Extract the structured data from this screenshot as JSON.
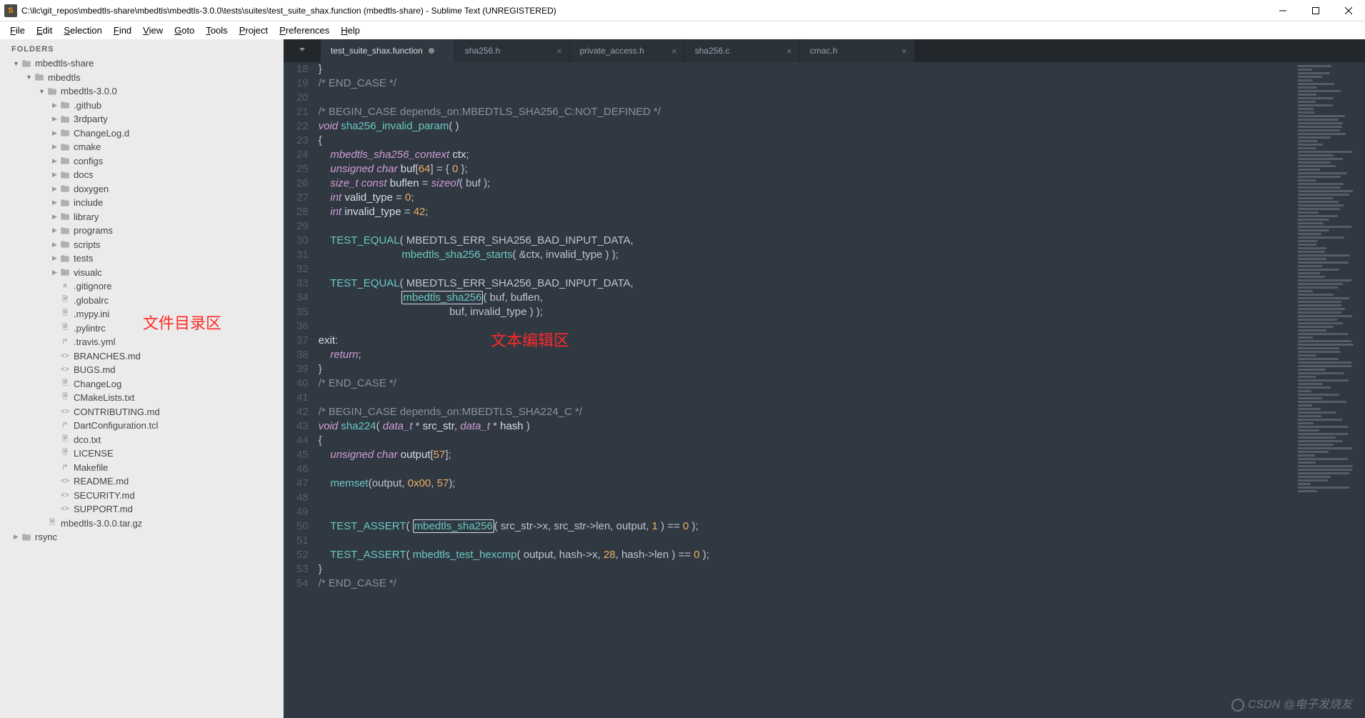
{
  "window": {
    "title": "C:\\llc\\git_repos\\mbedtls-share\\mbedtls\\mbedtls-3.0.0\\tests\\suites\\test_suite_shax.function (mbedtls-share) - Sublime Text (UNREGISTERED)",
    "app_icon_letter": "S"
  },
  "menu": [
    "File",
    "Edit",
    "Selection",
    "Find",
    "View",
    "Goto",
    "Tools",
    "Project",
    "Preferences",
    "Help"
  ],
  "sidebar": {
    "header": "FOLDERS",
    "tree": [
      {
        "depth": 0,
        "type": "folder",
        "arrow": "▼",
        "name": "mbedtls-share"
      },
      {
        "depth": 1,
        "type": "folder",
        "arrow": "▼",
        "name": "mbedtls"
      },
      {
        "depth": 2,
        "type": "folder",
        "arrow": "▼",
        "name": "mbedtls-3.0.0"
      },
      {
        "depth": 3,
        "type": "folder",
        "arrow": "▶",
        "name": ".github"
      },
      {
        "depth": 3,
        "type": "folder",
        "arrow": "▶",
        "name": "3rdparty"
      },
      {
        "depth": 3,
        "type": "folder",
        "arrow": "▶",
        "name": "ChangeLog.d"
      },
      {
        "depth": 3,
        "type": "folder",
        "arrow": "▶",
        "name": "cmake"
      },
      {
        "depth": 3,
        "type": "folder",
        "arrow": "▶",
        "name": "configs"
      },
      {
        "depth": 3,
        "type": "folder",
        "arrow": "▶",
        "name": "docs"
      },
      {
        "depth": 3,
        "type": "folder",
        "arrow": "▶",
        "name": "doxygen"
      },
      {
        "depth": 3,
        "type": "folder",
        "arrow": "▶",
        "name": "include"
      },
      {
        "depth": 3,
        "type": "folder",
        "arrow": "▶",
        "name": "library"
      },
      {
        "depth": 3,
        "type": "folder",
        "arrow": "▶",
        "name": "programs"
      },
      {
        "depth": 3,
        "type": "folder",
        "arrow": "▶",
        "name": "scripts"
      },
      {
        "depth": 3,
        "type": "folder",
        "arrow": "▶",
        "name": "tests"
      },
      {
        "depth": 3,
        "type": "folder",
        "arrow": "▶",
        "name": "visualc"
      },
      {
        "depth": 3,
        "type": "file",
        "icon": "≡",
        "name": ".gitignore"
      },
      {
        "depth": 3,
        "type": "file",
        "icon": "🗎",
        "name": ".globalrc"
      },
      {
        "depth": 3,
        "type": "file",
        "icon": "🗎",
        "name": ".mypy.ini"
      },
      {
        "depth": 3,
        "type": "file",
        "icon": "🗎",
        "name": ".pylintrc"
      },
      {
        "depth": 3,
        "type": "file",
        "icon": "/*",
        "name": ".travis.yml"
      },
      {
        "depth": 3,
        "type": "file",
        "icon": "<>",
        "name": "BRANCHES.md"
      },
      {
        "depth": 3,
        "type": "file",
        "icon": "<>",
        "name": "BUGS.md"
      },
      {
        "depth": 3,
        "type": "file",
        "icon": "🗎",
        "name": "ChangeLog"
      },
      {
        "depth": 3,
        "type": "file",
        "icon": "🗎",
        "name": "CMakeLists.txt"
      },
      {
        "depth": 3,
        "type": "file",
        "icon": "<>",
        "name": "CONTRIBUTING.md"
      },
      {
        "depth": 3,
        "type": "file",
        "icon": "/*",
        "name": "DartConfiguration.tcl"
      },
      {
        "depth": 3,
        "type": "file",
        "icon": "🗎",
        "name": "dco.txt"
      },
      {
        "depth": 3,
        "type": "file",
        "icon": "🗎",
        "name": "LICENSE"
      },
      {
        "depth": 3,
        "type": "file",
        "icon": "/*",
        "name": "Makefile"
      },
      {
        "depth": 3,
        "type": "file",
        "icon": "<>",
        "name": "README.md"
      },
      {
        "depth": 3,
        "type": "file",
        "icon": "<>",
        "name": "SECURITY.md"
      },
      {
        "depth": 3,
        "type": "file",
        "icon": "<>",
        "name": "SUPPORT.md"
      },
      {
        "depth": 2,
        "type": "file",
        "icon": "🗎",
        "name": "mbedtls-3.0.0.tar.gz"
      },
      {
        "depth": 0,
        "type": "folder",
        "arrow": "▶",
        "name": "rsync"
      }
    ]
  },
  "tabs": [
    {
      "label": "test_suite_shax.function",
      "active": true,
      "dirty": true
    },
    {
      "label": "sha256.h",
      "active": false
    },
    {
      "label": "private_access.h",
      "active": false
    },
    {
      "label": "sha256.c",
      "active": false
    },
    {
      "label": "cmac.h",
      "active": false
    }
  ],
  "code": {
    "first_line_number": 18,
    "lines": [
      {
        "n": 18,
        "html": "<span class='c-punc'>}</span>"
      },
      {
        "n": 19,
        "html": "<span class='c-comment'>/* END_CASE */</span>"
      },
      {
        "n": 20,
        "html": ""
      },
      {
        "n": 21,
        "html": "<span class='c-comment'>/* BEGIN_CASE depends_on:MBEDTLS_SHA256_C:NOT_DEFINED */</span>"
      },
      {
        "n": 22,
        "html": "<span class='c-type'>void</span> <span class='c-func'>sha256_invalid_param</span><span class='c-punc'>( )</span>"
      },
      {
        "n": 23,
        "html": "<span class='c-punc'>{</span>"
      },
      {
        "n": 24,
        "html": "    <span class='c-type'>mbedtls_sha256_context</span> <span class='c-var'>ctx</span><span class='c-punc'>;</span>"
      },
      {
        "n": 25,
        "html": "    <span class='c-type'>unsigned</span> <span class='c-type'>char</span> <span class='c-var'>buf</span><span class='c-punc'>[</span><span class='c-num'>64</span><span class='c-punc'>] = { </span><span class='c-num'>0</span><span class='c-punc'> };</span>"
      },
      {
        "n": 26,
        "html": "    <span class='c-type'>size_t</span> <span class='c-keyword'>const</span> <span class='c-var'>buflen</span> <span class='c-punc'>=</span> <span class='c-keyword'>sizeof</span><span class='c-punc'>( buf );</span>"
      },
      {
        "n": 27,
        "html": "    <span class='c-type'>int</span> <span class='c-var'>valid_type</span> <span class='c-punc'>=</span> <span class='c-num'>0</span><span class='c-punc'>;</span>"
      },
      {
        "n": 28,
        "html": "    <span class='c-type'>int</span> <span class='c-var'>invalid_type</span> <span class='c-punc'>=</span> <span class='c-num'>42</span><span class='c-punc'>;</span>"
      },
      {
        "n": 29,
        "html": ""
      },
      {
        "n": 30,
        "html": "    <span class='c-func'>TEST_EQUAL</span><span class='c-punc'>( MBEDTLS_ERR_SHA256_BAD_INPUT_DATA,</span>"
      },
      {
        "n": 31,
        "html": "                            <span class='c-func'>mbedtls_sha256_starts</span><span class='c-punc'>( &amp;ctx, invalid_type ) );</span>"
      },
      {
        "n": 32,
        "html": ""
      },
      {
        "n": 33,
        "html": "    <span class='c-func'>TEST_EQUAL</span><span class='c-punc'>( MBEDTLS_ERR_SHA256_BAD_INPUT_DATA,</span>"
      },
      {
        "n": 34,
        "html": "                            <span class='highlight-box'><span class='c-func'>mbedtls_sha256</span></span><span class='c-punc'>( buf, buflen,</span>"
      },
      {
        "n": 35,
        "html": "                                            <span class='c-punc'>buf, invalid_type ) );</span>"
      },
      {
        "n": 36,
        "html": ""
      },
      {
        "n": 37,
        "html": "<span class='c-label'>exit</span><span class='c-punc'>:</span>"
      },
      {
        "n": 38,
        "html": "    <span class='c-keyword'>return</span><span class='c-punc'>;</span>"
      },
      {
        "n": 39,
        "html": "<span class='c-punc'>}</span>"
      },
      {
        "n": 40,
        "html": "<span class='c-comment'>/* END_CASE */</span>"
      },
      {
        "n": 41,
        "html": ""
      },
      {
        "n": 42,
        "html": "<span class='c-comment'>/* BEGIN_CASE depends_on:MBEDTLS_SHA224_C */</span>"
      },
      {
        "n": 43,
        "html": "<span class='c-type'>void</span> <span class='c-func'>sha224</span><span class='c-punc'>( </span><span class='c-type'>data_t</span> <span class='c-punc'>*</span> <span class='c-var'>src_str</span><span class='c-punc'>, </span><span class='c-type'>data_t</span> <span class='c-punc'>*</span> <span class='c-var'>hash</span><span class='c-punc'> )</span>"
      },
      {
        "n": 44,
        "html": "<span class='c-punc'>{</span>"
      },
      {
        "n": 45,
        "html": "    <span class='c-type'>unsigned</span> <span class='c-type'>char</span> <span class='c-var'>output</span><span class='c-punc'>[</span><span class='c-num'>57</span><span class='c-punc'>];</span>"
      },
      {
        "n": 46,
        "html": ""
      },
      {
        "n": 47,
        "html": "    <span class='c-func'>memset</span><span class='c-punc'>(output, </span><span class='c-num'>0x00</span><span class='c-punc'>, </span><span class='c-num'>57</span><span class='c-punc'>);</span>"
      },
      {
        "n": 48,
        "html": ""
      },
      {
        "n": 49,
        "html": ""
      },
      {
        "n": 50,
        "html": "    <span class='c-func'>TEST_ASSERT</span><span class='c-punc'>( </span><span class='highlight-box'><span class='c-func'>mbedtls_sha256</span></span><span class='c-punc'>( src_str-&gt;x, src_str-&gt;len, output, </span><span class='c-num'>1</span><span class='c-punc'> ) == </span><span class='c-num'>0</span><span class='c-punc'> );</span>"
      },
      {
        "n": 51,
        "html": ""
      },
      {
        "n": 52,
        "html": "    <span class='c-func'>TEST_ASSERT</span><span class='c-punc'>( </span><span class='c-func'>mbedtls_test_hexcmp</span><span class='c-punc'>( output, hash-&gt;x, </span><span class='c-num'>28</span><span class='c-punc'>, hash-&gt;len ) == </span><span class='c-num'>0</span><span class='c-punc'> );</span>"
      },
      {
        "n": 53,
        "html": "<span class='c-punc'>}</span>"
      },
      {
        "n": 54,
        "html": "<span class='c-comment'>/* END_CASE */</span>"
      }
    ]
  },
  "annotations": {
    "sidebar_label": "文件目录区",
    "editor_label": "文本编辑区"
  },
  "watermark": "CSDN @电子发烧友"
}
